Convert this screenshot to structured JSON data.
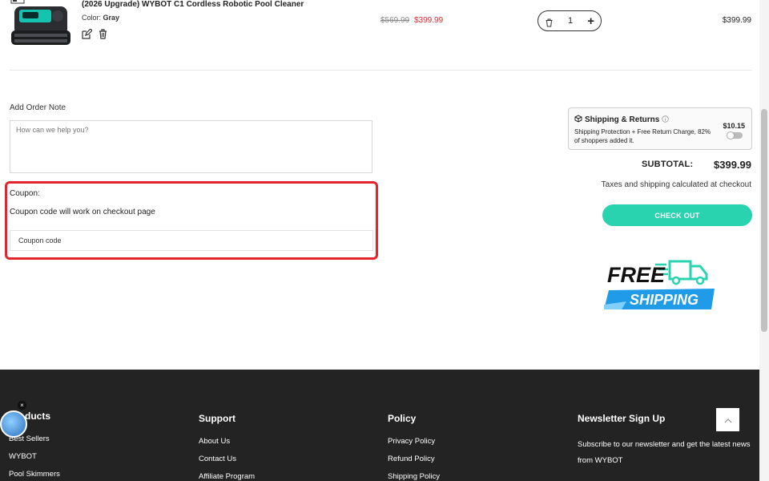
{
  "product": {
    "title": "(2026 Upgrade) WYBOT C1 Cordless Robotic Pool Cleaner",
    "color_label": "Color:",
    "color_value": "Gray",
    "price_original": "$569.99",
    "price_sale": "$399.99",
    "quantity": "1",
    "line_total": "$399.99"
  },
  "order_note": {
    "label": "Add Order Note",
    "placeholder": "How can we help you?"
  },
  "coupon": {
    "label": "Coupon:",
    "help": "Coupon code will work on checkout page",
    "placeholder": "Coupon code"
  },
  "shipping_protection": {
    "title": "Shipping & Returns",
    "description": "Shipping Protection + Free Return Charge, 82% of shoppers added it.",
    "price": "$10.15",
    "enabled": false
  },
  "summary": {
    "subtotal_label": "SUBTOTAL:",
    "subtotal_value": "$399.99",
    "tax_note": "Taxes and shipping calculated at checkout",
    "checkout_label": "CHECK OUT"
  },
  "free_shipping": {
    "line1": "FREE",
    "line2": "SHIPPING"
  },
  "footer": {
    "products": {
      "heading": "ducts",
      "links": [
        "Best Sellers",
        "WYBOT",
        "Pool Skimmers"
      ]
    },
    "support": {
      "heading": "Support",
      "links": [
        "About Us",
        "Contact Us",
        "Affiliate Program"
      ]
    },
    "policy": {
      "heading": "Policy",
      "links": [
        "Privacy Policy",
        "Refund Policy",
        "Shipping Policy"
      ]
    },
    "newsletter": {
      "heading": "Newsletter Sign Up",
      "text": "Subscribe to our newsletter and get the latest news from WYBOT"
    }
  },
  "colors": {
    "accent": "#2ad3b0",
    "sale": "#e0282e",
    "highlight_border": "#e3262d",
    "footer_bg": "#232323"
  },
  "icons": [
    "edit-icon",
    "trash-icon",
    "plus-icon",
    "info-icon",
    "box-icon",
    "chevron-up-icon",
    "close-icon"
  ]
}
